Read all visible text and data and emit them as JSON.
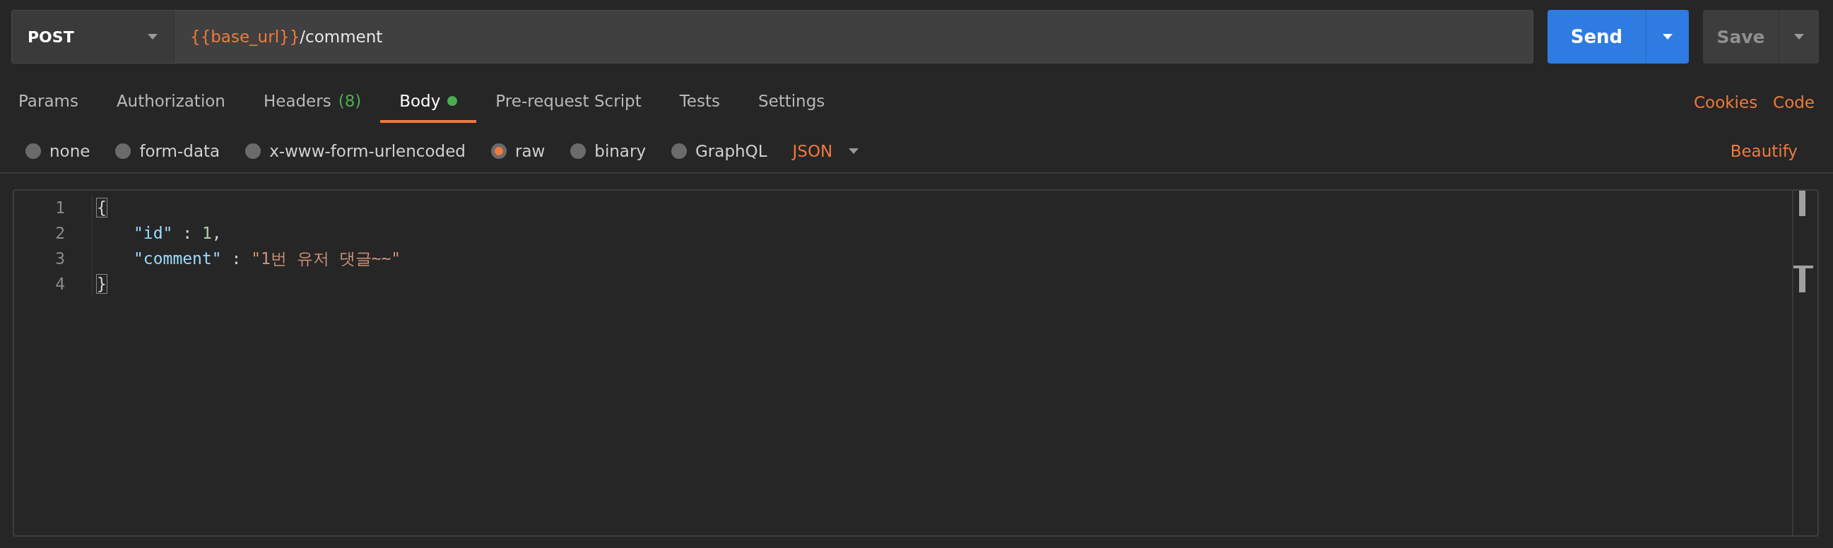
{
  "request": {
    "method": "POST",
    "url_variable": "{{base_url}}",
    "url_path": "/comment"
  },
  "send_button": {
    "label": "Send"
  },
  "save_button": {
    "label": "Save",
    "disabled": true
  },
  "tabs": [
    {
      "label": "Params",
      "selected": false
    },
    {
      "label": "Authorization",
      "selected": false
    },
    {
      "label": "Headers",
      "count": "(8)",
      "selected": false
    },
    {
      "label": "Body",
      "selected": true,
      "has_content": true
    },
    {
      "label": "Pre-request Script",
      "selected": false
    },
    {
      "label": "Tests",
      "selected": false
    },
    {
      "label": "Settings",
      "selected": false
    }
  ],
  "tab_links": [
    "Cookies",
    "Code"
  ],
  "body_types": [
    {
      "label": "none",
      "selected": false
    },
    {
      "label": "form-data",
      "selected": false
    },
    {
      "label": "x-www-form-urlencoded",
      "selected": false
    },
    {
      "label": "raw",
      "selected": true
    },
    {
      "label": "binary",
      "selected": false
    },
    {
      "label": "GraphQL",
      "selected": false
    }
  ],
  "format_dropdown": {
    "value": "JSON"
  },
  "beautify_link": "Beautify",
  "editor": {
    "lines": [
      {
        "number": "1",
        "indent": false,
        "tokens": [
          {
            "kind": "bracket-match",
            "text": "{"
          }
        ]
      },
      {
        "number": "2",
        "indent": true,
        "tokens": [
          {
            "kind": "key",
            "text": "\"id\""
          },
          {
            "kind": "punct",
            "text": " : "
          },
          {
            "kind": "number",
            "text": "1"
          },
          {
            "kind": "punct",
            "text": ","
          }
        ]
      },
      {
        "number": "3",
        "indent": true,
        "tokens": [
          {
            "kind": "key",
            "text": "\"comment\""
          },
          {
            "kind": "punct",
            "text": " : "
          },
          {
            "kind": "string",
            "text": "\"1번 유저 댓글~~\""
          }
        ]
      },
      {
        "number": "4",
        "indent": false,
        "tokens": [
          {
            "kind": "bracket-match",
            "text": "}"
          }
        ]
      }
    ]
  }
}
